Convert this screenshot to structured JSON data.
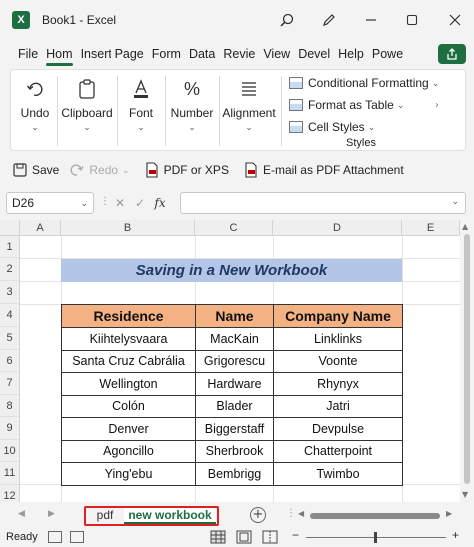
{
  "window": {
    "app_icon_letter": "X",
    "title": "Book1  -  Excel"
  },
  "menu": {
    "tabs": [
      "File",
      "Hom",
      "Insert",
      "Page",
      "Form",
      "Data",
      "Revie",
      "View",
      "Devel",
      "Help",
      "Powe"
    ],
    "active_index": 1
  },
  "ribbon": {
    "undo_label": "Undo",
    "clipboard_label": "Clipboard",
    "font_label": "Font",
    "number_label": "Number",
    "alignment_label": "Alignment",
    "conditional_formatting": "Conditional Formatting",
    "format_as_table": "Format as Table",
    "cell_styles": "Cell Styles",
    "styles_group_label": "Styles"
  },
  "qat": {
    "save": "Save",
    "redo": "Redo",
    "pdf_xps": "PDF or XPS",
    "email_pdf": "E-mail as PDF Attachment"
  },
  "formula_bar": {
    "name_box": "D26",
    "fx_label": "fx",
    "formula": ""
  },
  "grid": {
    "columns": [
      "A",
      "B",
      "C",
      "D",
      "E"
    ],
    "rows": [
      "1",
      "2",
      "3",
      "4",
      "5",
      "6",
      "7",
      "8",
      "9",
      "10",
      "11",
      "12"
    ]
  },
  "sheet": {
    "title": "Saving in a New Workbook",
    "headers": [
      "Residence",
      "Name",
      "Company Name"
    ],
    "rows": [
      [
        "Kiihtelysvaara",
        "MacKain",
        "Linklinks"
      ],
      [
        "Santa Cruz Cabrália",
        "Grigorescu",
        "Voonte"
      ],
      [
        "Wellington",
        "Hardware",
        "Rhynyx"
      ],
      [
        "Colón",
        "Blader",
        "Jatri"
      ],
      [
        "Denver",
        "Biggerstaff",
        "Devpulse"
      ],
      [
        "Agoncillo",
        "Sherbrook",
        "Chatterpoint"
      ],
      [
        "Ying'ebu",
        "Bembrigg",
        "Twimbo"
      ]
    ]
  },
  "sheet_tabs": {
    "tabs": [
      "pdf",
      "new workbook"
    ],
    "active": "new workbook",
    "add_symbol": "+"
  },
  "status": {
    "ready": "Ready"
  },
  "colors": {
    "excel_green": "#1d6f42",
    "banner_fill": "#b4c6e7",
    "header_fill": "#f4b183",
    "highlight_frame": "#e02020"
  }
}
